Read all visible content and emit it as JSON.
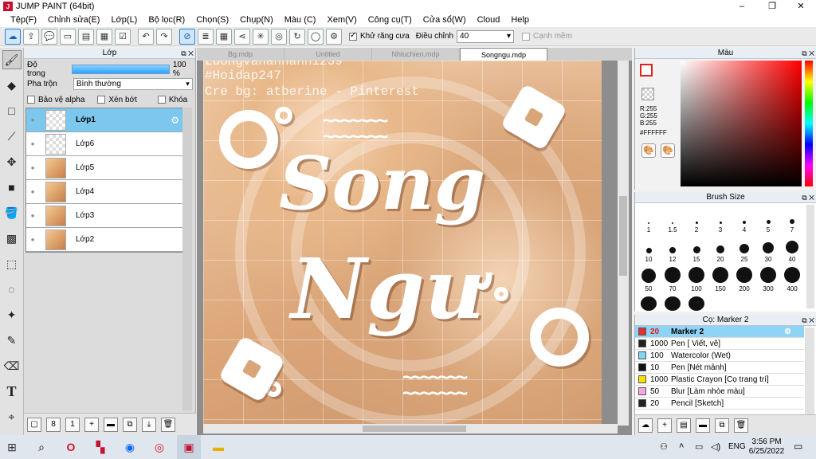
{
  "window": {
    "title": "JUMP PAINT (64bit)",
    "app_icon": "J",
    "controls": [
      "–",
      "❐",
      "✕"
    ]
  },
  "menu": [
    "Tệp(F)",
    "Chỉnh sửa(E)",
    "Lớp(L)",
    "Bộ lọc(R)",
    "Chọn(S)",
    "Chụp(N)",
    "Màu (C)",
    "Xem(V)",
    "Công cụ(T)",
    "Cửa sổ(W)",
    "Cloud",
    "Help"
  ],
  "toolbar": {
    "antialias_label": "Khử răng cưa",
    "correction_label": "Điều chỉnh",
    "correction_value": "40",
    "snap_label": "Cạnh mềm"
  },
  "layers_panel": {
    "title": "Lớp",
    "opacity_label": "Độ trong",
    "opacity_value": "100 %",
    "blend_label": "Pha trộn",
    "blend_value": "Bình thường",
    "protect_alpha": "Bảo vệ alpha",
    "clipping": "Xén bớt",
    "lock": "Khóa",
    "layers": [
      {
        "name": "Lớp1",
        "selected": true
      },
      {
        "name": "Lớp6",
        "selected": false
      },
      {
        "name": "Lớp5",
        "selected": false
      },
      {
        "name": "Lớp4",
        "selected": false
      },
      {
        "name": "Lớp3",
        "selected": false
      },
      {
        "name": "Lớp2",
        "selected": false
      }
    ]
  },
  "tabs": [
    "Bg.mdp",
    "Untitled",
    "Nhiuchien.mdp",
    "Songngu.mdp"
  ],
  "artwork": {
    "watermark1": "Luongvananhanh1239",
    "watermark2": "#Hoidap247",
    "watermark3": "Cre bg: atberine - Pinterest",
    "title1": "Song",
    "title2": "Ngư"
  },
  "color_panel": {
    "title": "Màu",
    "r": "R:255",
    "g": "G:255",
    "b": "B:255",
    "hex": "#FFFFFF"
  },
  "brush_panel": {
    "title": "Brush Size",
    "sizes": [
      "1",
      "1.5",
      "2",
      "3",
      "4",
      "5",
      "7",
      "10",
      "12",
      "15",
      "20",
      "25",
      "30",
      "40",
      "50",
      "70",
      "100",
      "150",
      "200",
      "300",
      "400"
    ]
  },
  "pen_panel": {
    "title": "Cọ: Marker 2",
    "pens": [
      {
        "size": "20",
        "name": "Marker 2",
        "color": "#e03030",
        "selected": true
      },
      {
        "size": "1000",
        "name": "Pen [ Viết, vẽ]",
        "color": "#222222",
        "selected": false
      },
      {
        "size": "100",
        "name": "Watercolor (Wet)",
        "color": "#7fd6f0",
        "selected": false
      },
      {
        "size": "10",
        "name": "Pen [Nét mảnh]",
        "color": "#111111",
        "selected": false
      },
      {
        "size": "1000",
        "name": "Plastic Crayon [Cọ trang trí]",
        "color": "#f5e000",
        "selected": false
      },
      {
        "size": "50",
        "name": "Blur [Làm nhòe màu]",
        "color": "#f2a8e0",
        "selected": false
      },
      {
        "size": "20",
        "name": "Pencil [Sketch]",
        "color": "#222222",
        "selected": false
      }
    ]
  },
  "taskbar": {
    "lang": "ENG",
    "time": "3:56 PM",
    "date": "6/25/2022"
  }
}
